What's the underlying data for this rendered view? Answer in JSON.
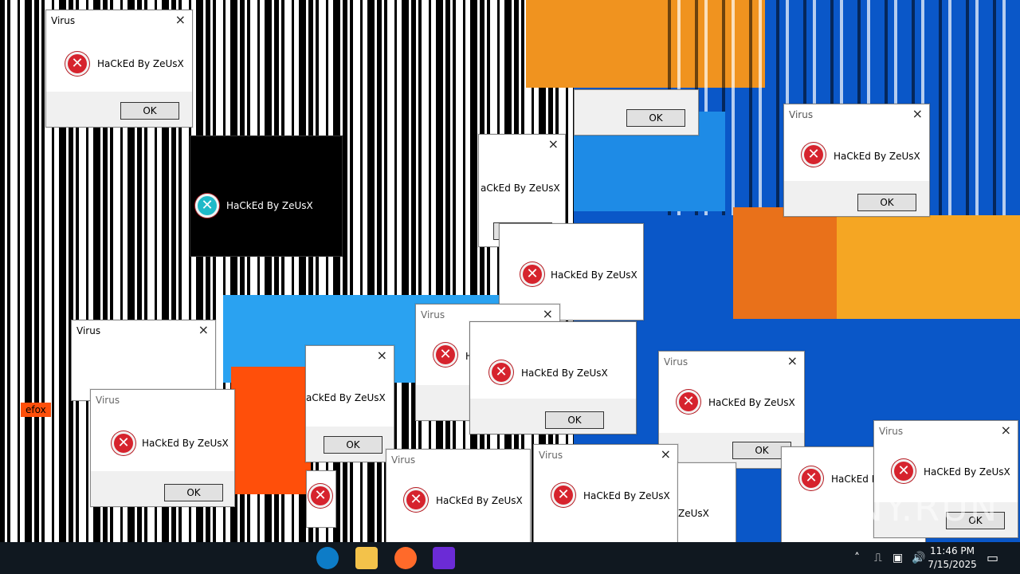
{
  "dialog": {
    "title": "Virus",
    "message": "HaCkEd By ZeUsX",
    "ok_label": "OK",
    "close_glyph": "×"
  },
  "glitch_fragments": {
    "partial_msg_1": "HaCkEd By ZeUsX",
    "partial_msg_2": "aCkEd By ZeUsX",
    "partial_msg_3": "H",
    "firefox": "efox"
  },
  "taskbar": {
    "time": "11:46 PM",
    "date": "7/15/2025",
    "icons": [
      "edge-icon",
      "file-explorer-icon",
      "firefox-icon",
      "visual-studio-icon"
    ]
  },
  "watermark": "ANY.RUN",
  "colors": {
    "error_red": "#d6232d",
    "taskbar": "#101820",
    "desktop_blue": "#0a57c8"
  }
}
